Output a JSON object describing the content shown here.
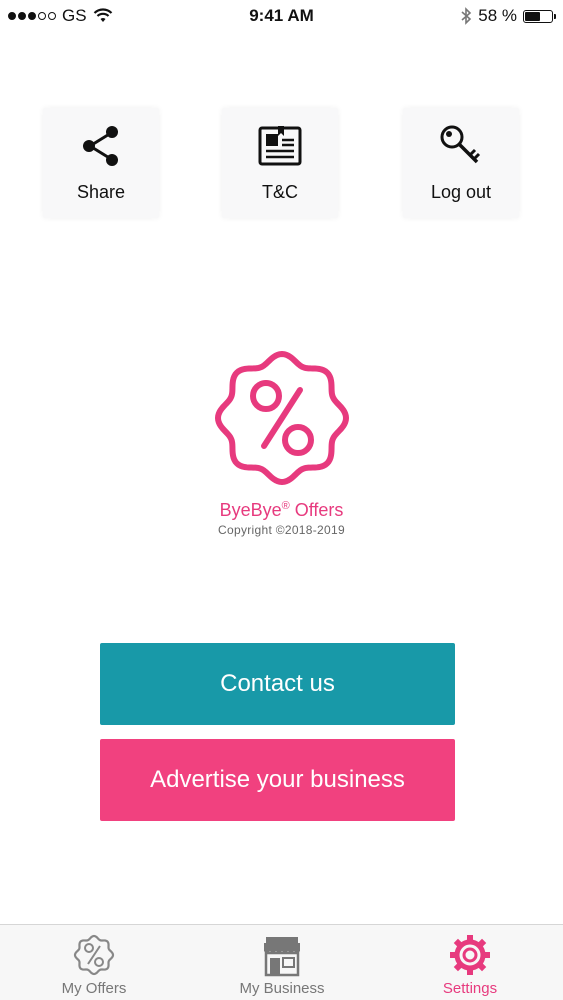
{
  "status_bar": {
    "carrier": "GS",
    "time": "9:41 AM",
    "battery_percent": "58 %",
    "battery_level": 0.58,
    "signal_bars_filled": 3,
    "signal_bars_total": 5
  },
  "actions": [
    {
      "label": "Share",
      "icon": "share-icon"
    },
    {
      "label": "T&C",
      "icon": "document-icon"
    },
    {
      "label": "Log out",
      "icon": "key-icon"
    }
  ],
  "brand": {
    "name": "ByeBye",
    "registered": "®",
    "name_suffix": " Offers",
    "copyright": "Copyright ©2018-2019",
    "color": "#e73a7e"
  },
  "buttons": {
    "contact": "Contact us",
    "advertise": "Advertise your business",
    "contact_color": "#1899a8",
    "advertise_color": "#f1417f"
  },
  "tabs": [
    {
      "label": "My Offers",
      "icon": "percent-badge-icon",
      "active": false
    },
    {
      "label": "My Business",
      "icon": "store-icon",
      "active": false
    },
    {
      "label": "Settings",
      "icon": "settings-gear-icon",
      "active": true
    }
  ]
}
